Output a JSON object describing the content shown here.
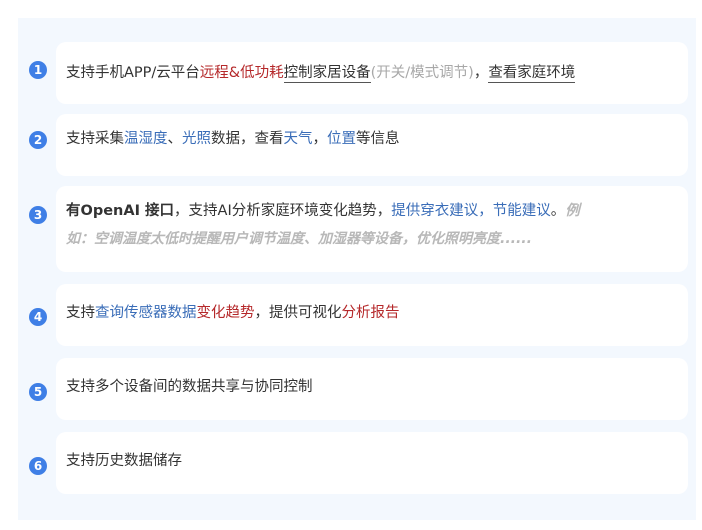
{
  "items": [
    {
      "number": "1",
      "segments": [
        {
          "text": "支持手机APP/云平台",
          "style": "normal"
        },
        {
          "text": "远程&低功耗",
          "style": "red"
        },
        {
          "text": "控制家居设备",
          "style": "underline"
        },
        {
          "text": "(开关/模式调节)",
          "style": "gray"
        },
        {
          "text": "，",
          "style": "normal"
        },
        {
          "text": "查看家庭环境",
          "style": "underline"
        }
      ]
    },
    {
      "number": "2",
      "segments": [
        {
          "text": "支持采集",
          "style": "normal"
        },
        {
          "text": "温湿度",
          "style": "blue"
        },
        {
          "text": "、",
          "style": "normal"
        },
        {
          "text": "光照",
          "style": "blue"
        },
        {
          "text": "数据，查看",
          "style": "normal"
        },
        {
          "text": "天气",
          "style": "blue"
        },
        {
          "text": "，",
          "style": "normal"
        },
        {
          "text": "位置",
          "style": "blue"
        },
        {
          "text": "等信息",
          "style": "normal"
        }
      ]
    },
    {
      "number": "3",
      "line1": [
        {
          "text": "有OpenAI 接口",
          "style": "bold"
        },
        {
          "text": "，支持AI分析家庭环境变化趋势，",
          "style": "normal"
        },
        {
          "text": "提供穿衣建议",
          "style": "blue"
        },
        {
          "text": "，",
          "style": "normal"
        },
        {
          "text": "节能建议",
          "style": "blue"
        },
        {
          "text": "。",
          "style": "normal"
        },
        {
          "text": "例",
          "style": "italic-gray"
        }
      ],
      "line2": [
        {
          "text": "如：空调温度太低时提醒用户调节温度、加湿器等设备，优化照明亮度......",
          "style": "italic-gray"
        }
      ]
    },
    {
      "number": "4",
      "segments": [
        {
          "text": "支持",
          "style": "normal"
        },
        {
          "text": "查询传感器数据",
          "style": "blue"
        },
        {
          "text": "变化趋势",
          "style": "red"
        },
        {
          "text": "，提供可视化",
          "style": "normal"
        },
        {
          "text": "分析报告",
          "style": "red"
        }
      ]
    },
    {
      "number": "5",
      "segments": [
        {
          "text": "支持多个设备间的数据共享与协同控制",
          "style": "normal"
        }
      ]
    },
    {
      "number": "6",
      "segments": [
        {
          "text": "支持历史数据储存",
          "style": "normal"
        }
      ]
    }
  ],
  "colors": {
    "panel_bg": "#f3f8fe",
    "badge": "#3f7fe6",
    "blue_text": "#3a6db8",
    "red_text": "#b5282a",
    "gray_text": "#a8a8a8"
  }
}
